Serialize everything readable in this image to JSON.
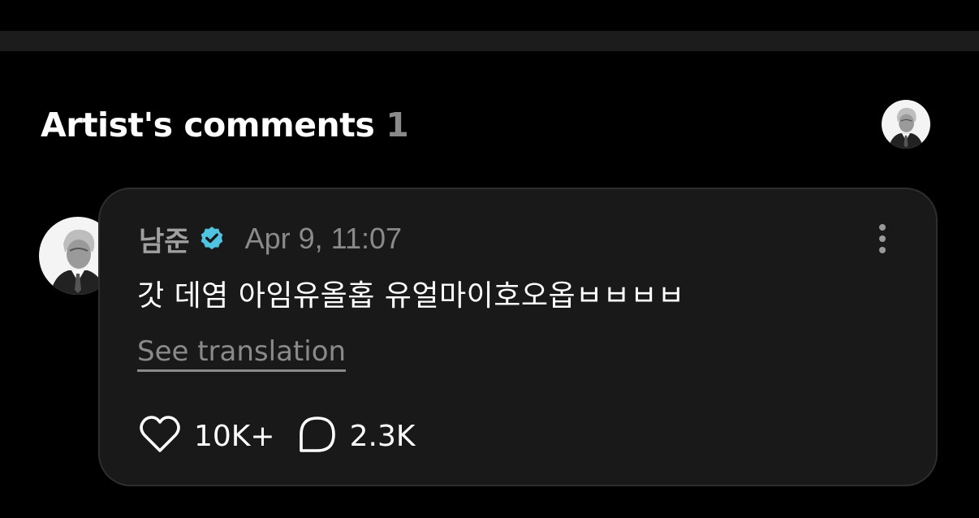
{
  "section": {
    "title": "Artist's comments",
    "count": "1"
  },
  "comment": {
    "author": "남준",
    "verified_icon": "verified-badge-icon",
    "verified_color": "#4fc3e0",
    "timestamp": "Apr 9, 11:07",
    "text": "갓 데염 아임유올홉 유얼마이호오옵ㅂㅂㅂㅂ",
    "see_translation": "See translation",
    "likes": "10K+",
    "replies": "2.3K",
    "like_icon": "heart-icon",
    "reply_icon": "speech-bubble-icon",
    "more_icon": "more-vertical-icon"
  },
  "colors": {
    "background": "#000000",
    "card": "#191919",
    "muted_text": "#8a8a8a"
  }
}
